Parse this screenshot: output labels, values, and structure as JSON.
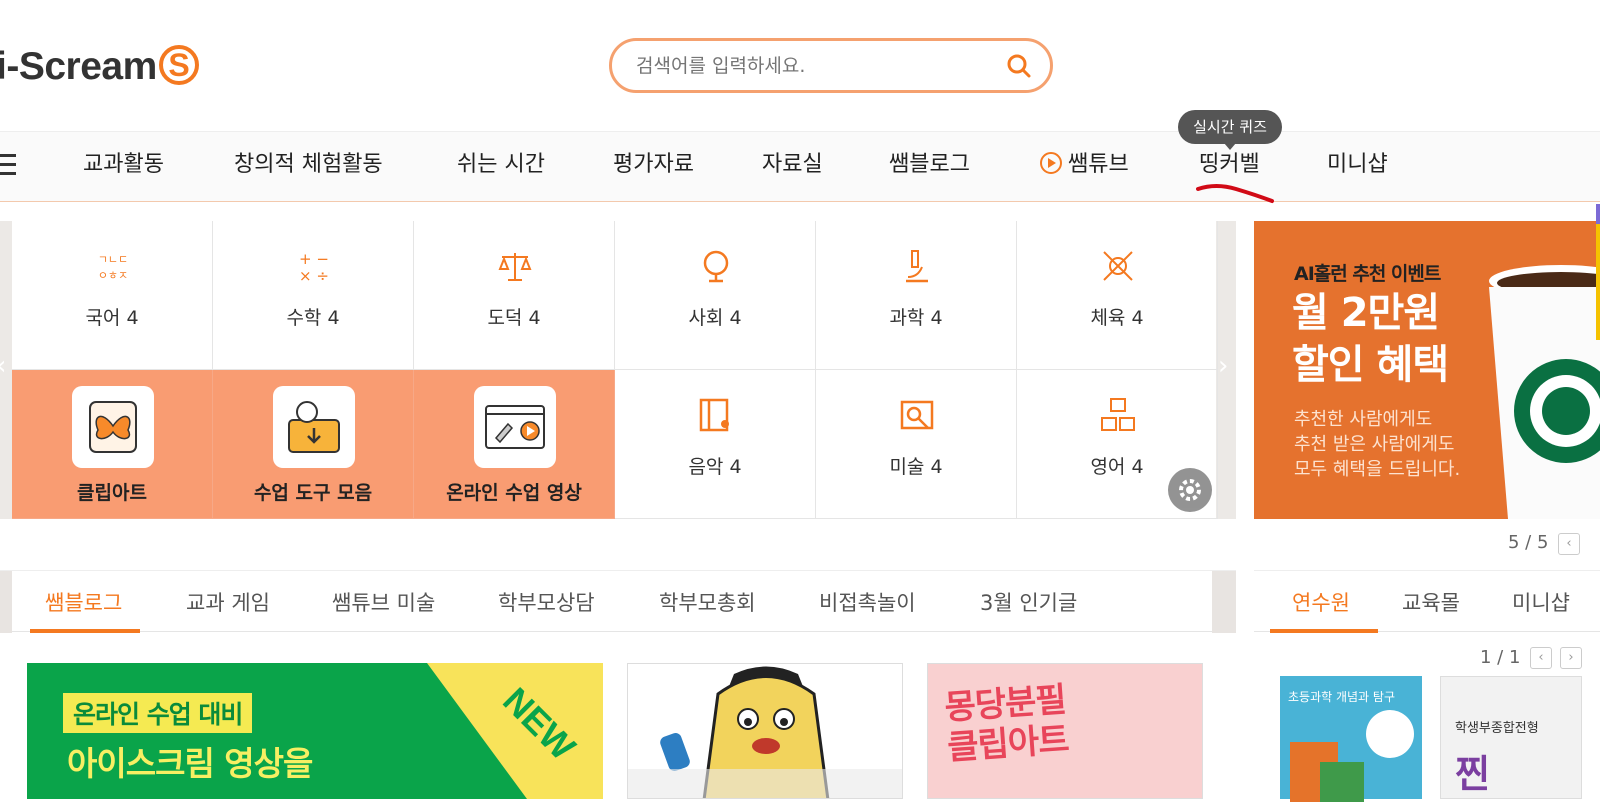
{
  "header": {
    "logo_text": "i-Scream",
    "logo_badge": "S",
    "search_placeholder": "검색어를 입력하세요."
  },
  "nav": {
    "items": [
      "교과활동",
      "창의적 체험활동",
      "쉬는 시간",
      "평가자료",
      "자료실",
      "쌤블로그",
      "쌤튜브",
      "띵커벨",
      "미니샵"
    ],
    "tooltip": "실시간 퀴즈"
  },
  "subjects": {
    "row1": [
      "국어 4",
      "수학 4",
      "도덕 4",
      "사회 4",
      "과학 4",
      "체육 4"
    ],
    "row2_shortcuts": [
      "클립아트",
      "수업 도구 모음",
      "온라인 수업 영상"
    ],
    "row2_subjects": [
      "음악 4",
      "미술 4",
      "영어 4"
    ]
  },
  "banner": {
    "small": "AI홀런 추천 이벤트",
    "big1": "월 2만원",
    "big2": "할인 혜택",
    "desc1": "추천한 사람에게도",
    "desc2": "추천 받은 사람에게도",
    "desc3": "모두 혜택을 드립니다."
  },
  "pager_top": "5 / 5",
  "tabs_main": [
    "쌤블로그",
    "교과 게임",
    "쌤튜브 미술",
    "학부모상담",
    "학부모총회",
    "비접촉놀이",
    "3월 인기글"
  ],
  "tabs_side": [
    "연수원",
    "교육몰",
    "미니샵"
  ],
  "pager_side": "1 / 1",
  "cards": {
    "c1_tag": "온라인 수업 대비",
    "c1_title": "아이스크림 영상을",
    "c1_new": "NEW",
    "c3_title1": "몽당분필",
    "c3_title2": "클립아트"
  },
  "books": {
    "b1": "초등과학 개념과 탐구",
    "b2_sub": "학생부종합전형",
    "b2_big": "찐"
  },
  "colors": {
    "accent": "#f47920",
    "shortcut_bg": "#f99c72",
    "banner_bg": "#e5722e"
  }
}
